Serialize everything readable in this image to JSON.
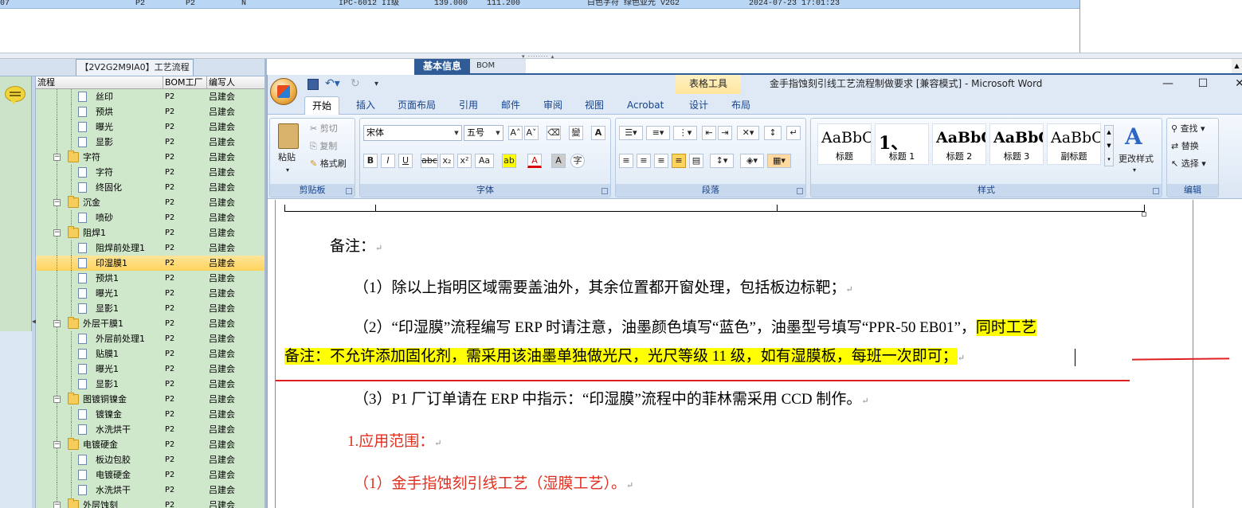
{
  "top_grid": {
    "row": [
      "07",
      "P2",
      "P2",
      "N",
      "IPC-6012 II级",
      "139.000",
      "111.200",
      "白色字符  绿色亚光  V2G2",
      "2024-07-23 17:01:23"
    ]
  },
  "left_panel": {
    "tab_title": "【2V2G2M9IA0】工艺流程",
    "columns": [
      "流程",
      "BOM工厂",
      "编写人"
    ],
    "rows": [
      {
        "level": 2,
        "type": "doc",
        "name": "丝印",
        "bom": "P2",
        "author": "吕建会"
      },
      {
        "level": 2,
        "type": "doc",
        "name": "预烘",
        "bom": "P2",
        "author": "吕建会"
      },
      {
        "level": 2,
        "type": "doc",
        "name": "曝光",
        "bom": "P2",
        "author": "吕建会"
      },
      {
        "level": 2,
        "type": "doc",
        "name": "显影",
        "bom": "P2",
        "author": "吕建会"
      },
      {
        "level": 1,
        "type": "folder",
        "name": "字符",
        "bom": "P2",
        "author": "吕建会"
      },
      {
        "level": 2,
        "type": "doc",
        "name": "字符",
        "bom": "P2",
        "author": "吕建会"
      },
      {
        "level": 2,
        "type": "doc",
        "name": "终固化",
        "bom": "P2",
        "author": "吕建会"
      },
      {
        "level": 1,
        "type": "folder",
        "name": "沉金",
        "bom": "P2",
        "author": "吕建会"
      },
      {
        "level": 2,
        "type": "doc",
        "name": "喷砂",
        "bom": "P2",
        "author": "吕建会"
      },
      {
        "level": 1,
        "type": "folder",
        "name": "阻焊1",
        "bom": "P2",
        "author": "吕建会"
      },
      {
        "level": 2,
        "type": "doc",
        "name": "阻焊前处理1",
        "bom": "P2",
        "author": "吕建会"
      },
      {
        "level": 2,
        "type": "doc",
        "name": "印湿膜1",
        "bom": "P2",
        "author": "吕建会",
        "selected": true
      },
      {
        "level": 2,
        "type": "doc",
        "name": "预烘1",
        "bom": "P2",
        "author": "吕建会"
      },
      {
        "level": 2,
        "type": "doc",
        "name": "曝光1",
        "bom": "P2",
        "author": "吕建会"
      },
      {
        "level": 2,
        "type": "doc",
        "name": "显影1",
        "bom": "P2",
        "author": "吕建会"
      },
      {
        "level": 1,
        "type": "folder",
        "name": "外层干膜1",
        "bom": "P2",
        "author": "吕建会"
      },
      {
        "level": 2,
        "type": "doc",
        "name": "外层前处理1",
        "bom": "P2",
        "author": "吕建会"
      },
      {
        "level": 2,
        "type": "doc",
        "name": "贴膜1",
        "bom": "P2",
        "author": "吕建会"
      },
      {
        "level": 2,
        "type": "doc",
        "name": "曝光1",
        "bom": "P2",
        "author": "吕建会"
      },
      {
        "level": 2,
        "type": "doc",
        "name": "显影1",
        "bom": "P2",
        "author": "吕建会"
      },
      {
        "level": 1,
        "type": "folder",
        "name": "图镀铜镍金",
        "bom": "P2",
        "author": "吕建会"
      },
      {
        "level": 2,
        "type": "doc",
        "name": "镀镍金",
        "bom": "P2",
        "author": "吕建会"
      },
      {
        "level": 2,
        "type": "doc",
        "name": "水洗烘干",
        "bom": "P2",
        "author": "吕建会"
      },
      {
        "level": 1,
        "type": "folder",
        "name": "电镀硬金",
        "bom": "P2",
        "author": "吕建会"
      },
      {
        "level": 2,
        "type": "doc",
        "name": "板边包胶",
        "bom": "P2",
        "author": "吕建会"
      },
      {
        "level": 2,
        "type": "doc",
        "name": "电镀硬金",
        "bom": "P2",
        "author": "吕建会"
      },
      {
        "level": 2,
        "type": "doc",
        "name": "水洗烘干",
        "bom": "P2",
        "author": "吕建会"
      },
      {
        "level": 1,
        "type": "folder",
        "name": "外层蚀刻",
        "bom": "P2",
        "author": "吕建会"
      }
    ]
  },
  "dock_tabs": {
    "basic_info": "基本信息",
    "bom": "BOM"
  },
  "word": {
    "context_tab": "表格工具",
    "title": "金手指蚀刻引线工艺流程制做要求 [兼容模式] - Microsoft Word",
    "window_buttons": {
      "minimize": "—",
      "maximize": "☐",
      "close": "✕"
    },
    "tabs": [
      "开始",
      "插入",
      "页面布局",
      "引用",
      "邮件",
      "审阅",
      "视图",
      "Acrobat",
      "设计",
      "布局"
    ],
    "clipboard": {
      "paste": "粘贴",
      "cut": "剪切",
      "copy": "复制",
      "format_painter": "格式刷",
      "label": "剪贴板"
    },
    "font": {
      "name": "宋体",
      "size": "五号",
      "label": "字体"
    },
    "paragraph": {
      "label": "段落"
    },
    "styles": {
      "items": [
        {
          "sample": "AaBbC",
          "name": "标题"
        },
        {
          "sample": "1、",
          "name": "标题 1"
        },
        {
          "sample": "AaBbC",
          "name": "标题 2"
        },
        {
          "sample": "AaBbC",
          "name": "标题 3"
        },
        {
          "sample": "AaBbC",
          "name": "副标题"
        }
      ],
      "change_styles": "更改样式",
      "label": "样式"
    },
    "editing": {
      "find": "查找",
      "replace": "替换",
      "select": "选择",
      "label": "编辑"
    }
  },
  "document": {
    "note_heading": "备注：",
    "p1": "（1）除以上指明区域需要盖油外，其余位置都开窗处理，包括板边标靶；",
    "p2_part1": "（2）“印湿膜”流程编写 ERP 时请注意，油墨颜色填写“蓝色”，油墨型号填写“PPR-50 EB01”，",
    "p2_hl1": "同时工艺",
    "p2_hl2": "备注：不允许添加固化剂，需采用该油墨单独做光尺，光尺等级 11 级，如有湿膜板，每班一次即可；",
    "p3": "（3）P1 厂订单请在 ERP 中指示：“印湿膜”流程中的菲林需采用 CCD 制作。",
    "scope_heading": "1.应用范围：",
    "scope_item1": "（1）金手指蚀刻引线工艺（湿膜工艺）。",
    "para_mark": "↵"
  },
  "colors": {
    "highlight": "#ffff00",
    "red_text": "#e03020",
    "tree_bg": "#cfe7cb",
    "selected_row": "#ffd35c"
  }
}
